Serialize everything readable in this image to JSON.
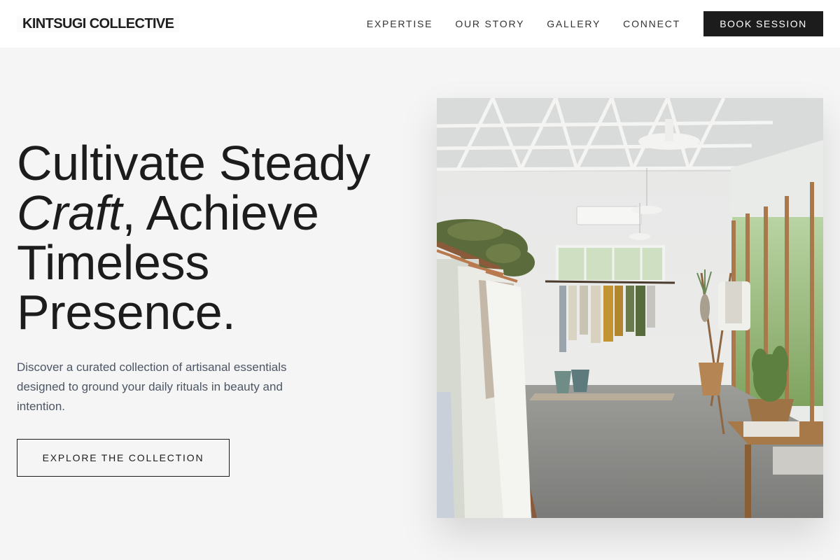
{
  "header": {
    "logo": "KINTSUGI COLLECTIVE",
    "nav": [
      "EXPERTISE",
      "OUR STORY",
      "GALLERY",
      "CONNECT"
    ],
    "cta": "BOOK SESSION"
  },
  "hero": {
    "headline_line1": "Cultivate Steady",
    "headline_italic": "Craft",
    "headline_rest": ", Achieve Timeless Presence.",
    "subtext": "Discover a curated collection of artisanal essentials designed to ground your daily rituals in beauty and intention.",
    "button": "EXPLORE THE COLLECTION"
  },
  "colors": {
    "background": "#f5f5f5",
    "header": "#ffffff",
    "text": "#1c1c1c",
    "subtext": "#4d5665",
    "cta_bg": "#1c1c1c"
  }
}
